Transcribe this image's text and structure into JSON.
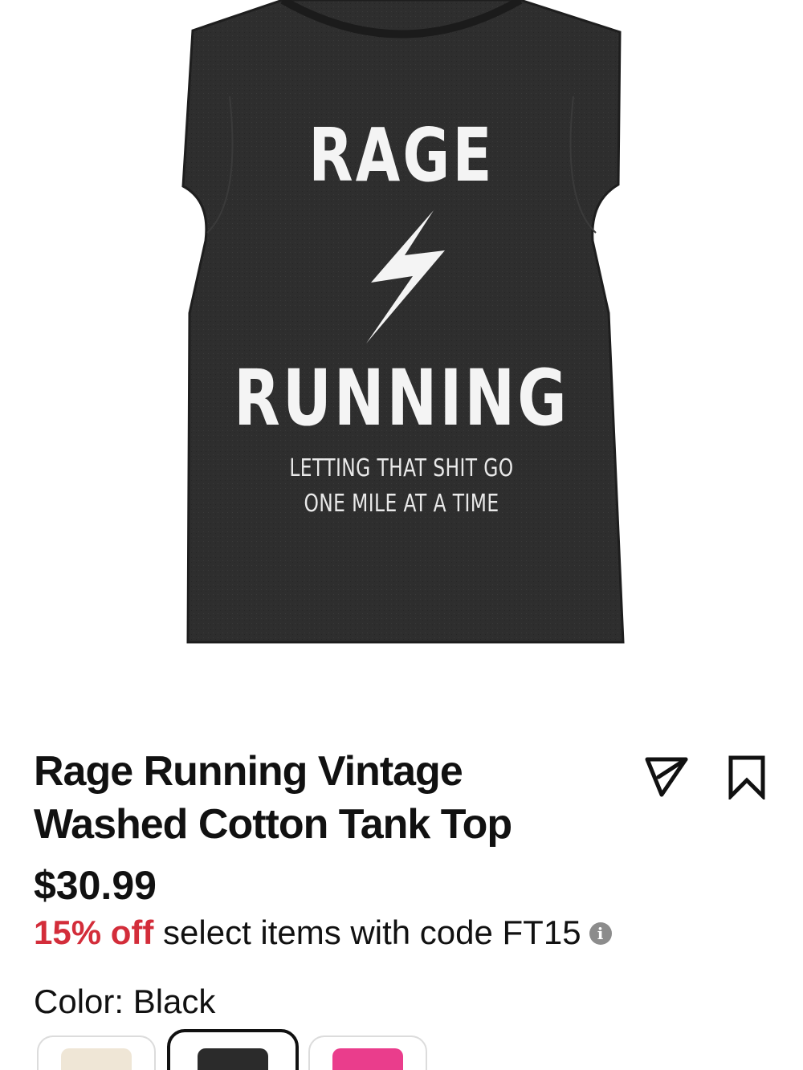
{
  "product": {
    "image_print": {
      "line1": "RAGE",
      "line2": "RUNNING",
      "line3": "LETTING THAT SHIT GO",
      "line4": "ONE MILE AT A TIME"
    },
    "title": "Rage Running Vintage Washed Cotton Tank Top",
    "price": "$30.99",
    "promo": {
      "highlight": "15% off",
      "text": " select items with code FT15"
    },
    "color": {
      "label": "Color: Black",
      "swatches": [
        {
          "name": "cream",
          "hex": "#efe6d6",
          "selected": false
        },
        {
          "name": "black",
          "hex": "#2b2b2b",
          "selected": true
        },
        {
          "name": "pink",
          "hex": "#ea3d8c",
          "selected": false
        }
      ]
    }
  },
  "icons": {
    "share": "send-triangle-icon",
    "save": "bookmark-icon",
    "info": "info-icon"
  },
  "colors": {
    "accent_red": "#d32d3a",
    "shirt": "#2e2e2e",
    "text": "#111111"
  }
}
